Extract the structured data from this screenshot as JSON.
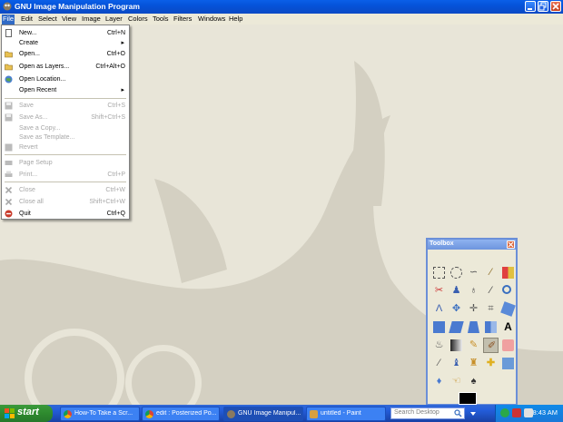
{
  "window": {
    "title": "GNU Image Manipulation Program"
  },
  "menubar": [
    "File",
    "Edit",
    "Select",
    "View",
    "Image",
    "Layer",
    "Colors",
    "Tools",
    "Filters",
    "Windows",
    "Help"
  ],
  "file_menu": {
    "items": [
      {
        "label": "New...",
        "shortcut": "Ctrl+N",
        "disabled": false,
        "icon": "new-icon"
      },
      {
        "label": "Create",
        "shortcut": "",
        "submenu": true,
        "disabled": false,
        "icon": ""
      },
      {
        "label": "Open...",
        "shortcut": "Ctrl+O",
        "disabled": false,
        "icon": "open-icon"
      },
      {
        "label": "Open as Layers...",
        "shortcut": "Ctrl+Alt+O",
        "disabled": false,
        "icon": "open-layers-icon"
      },
      {
        "label": "Open Location...",
        "shortcut": "",
        "disabled": false,
        "icon": "globe-icon"
      },
      {
        "label": "Open Recent",
        "shortcut": "",
        "submenu": true,
        "disabled": false,
        "icon": ""
      },
      {
        "label": "Save",
        "shortcut": "Ctrl+S",
        "disabled": true,
        "icon": "save-icon"
      },
      {
        "label": "Save As...",
        "shortcut": "Shift+Ctrl+S",
        "disabled": true,
        "icon": "save-as-icon"
      },
      {
        "label": "Save a Copy...",
        "shortcut": "",
        "disabled": true,
        "icon": ""
      },
      {
        "label": "Save as Template...",
        "shortcut": "",
        "disabled": true,
        "icon": ""
      },
      {
        "label": "Revert",
        "shortcut": "",
        "disabled": true,
        "icon": "revert-icon"
      },
      {
        "label": "Page Setup",
        "shortcut": "",
        "disabled": true,
        "icon": "page-setup-icon"
      },
      {
        "label": "Print...",
        "shortcut": "Ctrl+P",
        "disabled": true,
        "icon": "print-icon"
      },
      {
        "label": "Close",
        "shortcut": "Ctrl+W",
        "disabled": true,
        "icon": "close-icon"
      },
      {
        "label": "Close all",
        "shortcut": "Shift+Ctrl+W",
        "disabled": true,
        "icon": "close-all-icon"
      },
      {
        "label": "Quit",
        "shortcut": "Ctrl+Q",
        "disabled": false,
        "icon": "quit-icon"
      }
    ]
  },
  "toolbox": {
    "title": "Toolbox"
  },
  "taskbar": {
    "start_label": "start",
    "tasks": [
      {
        "label": "How-To Take a Scr...",
        "active": false
      },
      {
        "label": "edit : Posterized Po...",
        "active": false
      },
      {
        "label": "GNU Image Manipul...",
        "active": true
      },
      {
        "label": "untitled - Paint",
        "active": false
      }
    ],
    "search_placeholder": "Search Desktop",
    "clock": "8:43 AM"
  },
  "colors": {
    "accent": "#316ac5",
    "wilber_shape": "#d4d0c2",
    "background": "#e8e5d8"
  }
}
